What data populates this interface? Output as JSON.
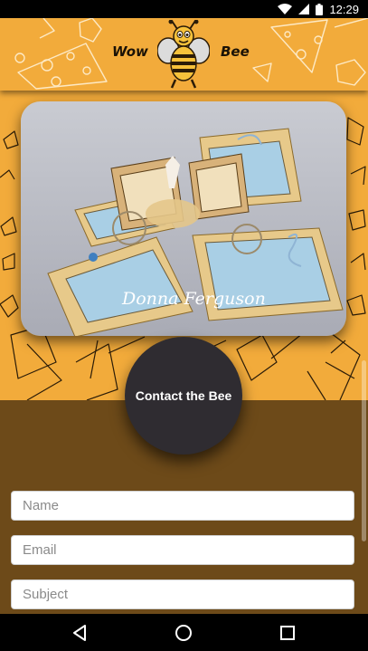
{
  "status_bar": {
    "time": "12:29",
    "icons": [
      "wifi-icon",
      "cellular-signal-icon",
      "battery-icon"
    ]
  },
  "header": {
    "logo_left": "Wow",
    "logo_right": "Bee",
    "logo_icon": "bee-mascot-icon"
  },
  "hero": {
    "image": "craft-card-photo",
    "watermark": "Donna Ferguson"
  },
  "contact": {
    "button_label": "Contact the Bee"
  },
  "form": {
    "name_placeholder": "Name",
    "email_placeholder": "Email",
    "subject_placeholder": "Subject"
  },
  "navigation": {
    "icons": [
      "back-icon",
      "home-icon",
      "recent-apps-icon"
    ]
  },
  "colors": {
    "honey": "#f2ab3b",
    "brown": "#6d4a19",
    "circle": "#2f2c31",
    "outline": "#2b1c08"
  }
}
